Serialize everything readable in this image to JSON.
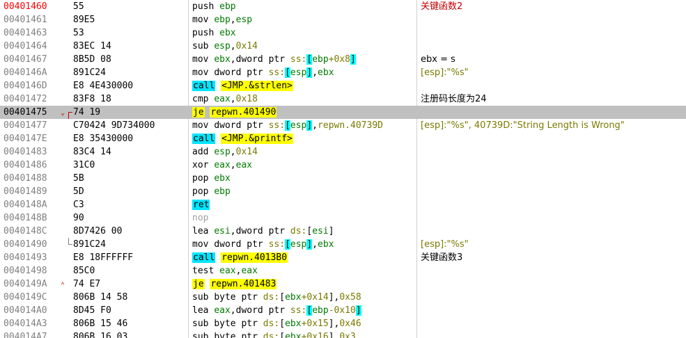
{
  "colors": {
    "eip_address": "#ff0000",
    "selected_row": "#c0c0c0",
    "call_highlight": "#00e5ff",
    "jump_highlight": "#ffff00",
    "register": "#007a00",
    "immediate": "#7a7a00",
    "comment_red": "#c00000"
  },
  "rows": [
    {
      "addr": "00401460",
      "bytes": "55",
      "asm": [
        [
          "mn",
          "push "
        ],
        [
          "reg",
          "ebp"
        ]
      ],
      "cmt": "关键函数2",
      "cmtClass": "red",
      "eip": true
    },
    {
      "addr": "00401461",
      "bytes": "89E5",
      "asm": [
        [
          "mn",
          "mov "
        ],
        [
          "reg",
          "ebp"
        ],
        [
          "txt",
          ","
        ],
        [
          "reg",
          "esp"
        ]
      ],
      "cmt": ""
    },
    {
      "addr": "00401463",
      "bytes": "53",
      "asm": [
        [
          "mn",
          "push "
        ],
        [
          "reg",
          "ebx"
        ]
      ],
      "cmt": ""
    },
    {
      "addr": "00401464",
      "bytes": "83EC 14",
      "asm": [
        [
          "mn",
          "sub "
        ],
        [
          "reg",
          "esp"
        ],
        [
          "txt",
          ","
        ],
        [
          "num",
          "0x14"
        ]
      ],
      "cmt": ""
    },
    {
      "addr": "00401467",
      "bytes": "8B5D 08",
      "asm": [
        [
          "mn",
          "mov "
        ],
        [
          "reg",
          "ebx"
        ],
        [
          "txt",
          ",dword ptr "
        ],
        [
          "seg",
          "ss:"
        ],
        [
          "br",
          "["
        ],
        [
          "reg",
          "ebp"
        ],
        [
          "num",
          "+0x8"
        ],
        [
          "br",
          "]"
        ]
      ],
      "cmt": "ebx = s"
    },
    {
      "addr": "0040146A",
      "bytes": "891C24",
      "asm": [
        [
          "mn",
          "mov "
        ],
        [
          "txt",
          "dword ptr "
        ],
        [
          "seg",
          "ss:"
        ],
        [
          "br",
          "["
        ],
        [
          "reg",
          "esp"
        ],
        [
          "br",
          "]"
        ],
        [
          "txt",
          ","
        ],
        [
          "reg",
          "ebx"
        ]
      ],
      "cmt": "[esp]:\"%s\"",
      "cmtClass": "olive"
    },
    {
      "addr": "0040146D",
      "bytes": "E8 4E430000",
      "asm": [
        [
          "call",
          "call"
        ],
        [
          "txt",
          " "
        ],
        [
          "jmp",
          "<JMP.&strlen>"
        ]
      ],
      "cmt": ""
    },
    {
      "addr": "00401472",
      "bytes": "83F8 18",
      "asm": [
        [
          "mn",
          "cmp "
        ],
        [
          "reg",
          "eax"
        ],
        [
          "txt",
          ","
        ],
        [
          "num",
          "0x18"
        ]
      ],
      "cmt": "注册码长度为24"
    },
    {
      "addr": "00401475",
      "bytes": "74 19",
      "asm": [
        [
          "jmpm",
          "je"
        ],
        [
          "txt",
          " "
        ],
        [
          "jmp",
          "repwn.401490"
        ]
      ],
      "cmt": "",
      "sel": true,
      "jumpMark": "down"
    },
    {
      "addr": "00401477",
      "bytes": "C70424 9D734000",
      "asm": [
        [
          "mn",
          "mov "
        ],
        [
          "txt",
          "dword ptr "
        ],
        [
          "seg",
          "ss:"
        ],
        [
          "br",
          "["
        ],
        [
          "reg",
          "esp"
        ],
        [
          "br",
          "]"
        ],
        [
          "txt",
          ","
        ],
        [
          "num",
          "repwn.40739D"
        ]
      ],
      "cmt": "[esp]:\"%s\", 40739D:\"String Length is Wrong\"",
      "cmtClass": "olive"
    },
    {
      "addr": "0040147E",
      "bytes": "E8 35430000",
      "asm": [
        [
          "call",
          "call"
        ],
        [
          "txt",
          " "
        ],
        [
          "jmp",
          "<JMP.&printf>"
        ]
      ],
      "cmt": ""
    },
    {
      "addr": "00401483",
      "bytes": "83C4 14",
      "asm": [
        [
          "mn",
          "add "
        ],
        [
          "reg",
          "esp"
        ],
        [
          "txt",
          ","
        ],
        [
          "num",
          "0x14"
        ]
      ],
      "cmt": ""
    },
    {
      "addr": "00401486",
      "bytes": "31C0",
      "asm": [
        [
          "mn",
          "xor "
        ],
        [
          "reg",
          "eax"
        ],
        [
          "txt",
          ","
        ],
        [
          "reg",
          "eax"
        ]
      ],
      "cmt": ""
    },
    {
      "addr": "00401488",
      "bytes": "5B",
      "asm": [
        [
          "mn",
          "pop "
        ],
        [
          "reg",
          "ebx"
        ]
      ],
      "cmt": ""
    },
    {
      "addr": "00401489",
      "bytes": "5D",
      "asm": [
        [
          "mn",
          "pop "
        ],
        [
          "reg",
          "ebp"
        ]
      ],
      "cmt": ""
    },
    {
      "addr": "0040148A",
      "bytes": "C3",
      "asm": [
        [
          "call",
          "ret"
        ]
      ],
      "cmt": ""
    },
    {
      "addr": "0040148B",
      "bytes": "90",
      "asm": [
        [
          "nop",
          "nop"
        ]
      ],
      "cmt": ""
    },
    {
      "addr": "0040148C",
      "bytes": "8D7426 00",
      "asm": [
        [
          "mn",
          "lea "
        ],
        [
          "reg",
          "esi"
        ],
        [
          "txt",
          ",dword ptr "
        ],
        [
          "seg",
          "ds:"
        ],
        [
          "txt",
          "["
        ],
        [
          "reg",
          "esi"
        ],
        [
          "txt",
          "]"
        ]
      ],
      "cmt": ""
    },
    {
      "addr": "00401490",
      "bytes": "891C24",
      "asm": [
        [
          "mn",
          "mov "
        ],
        [
          "txt",
          "dword ptr "
        ],
        [
          "seg",
          "ss:"
        ],
        [
          "br",
          "["
        ],
        [
          "reg",
          "esp"
        ],
        [
          "br",
          "]"
        ],
        [
          "txt",
          ","
        ],
        [
          "reg",
          "ebx"
        ]
      ],
      "cmt": "[esp]:\"%s\"",
      "cmtClass": "olive",
      "jumpMark": "target"
    },
    {
      "addr": "00401493",
      "bytes": "E8 18FFFFFF",
      "asm": [
        [
          "call",
          "call"
        ],
        [
          "txt",
          " "
        ],
        [
          "jmp",
          "repwn.4013B0"
        ]
      ],
      "cmt": "关键函数3"
    },
    {
      "addr": "00401498",
      "bytes": "85C0",
      "asm": [
        [
          "mn",
          "test "
        ],
        [
          "reg",
          "eax"
        ],
        [
          "txt",
          ","
        ],
        [
          "reg",
          "eax"
        ]
      ],
      "cmt": ""
    },
    {
      "addr": "0040149A",
      "bytes": "74 E7",
      "asm": [
        [
          "jmpm",
          "je"
        ],
        [
          "txt",
          " "
        ],
        [
          "jmp",
          "repwn.401483"
        ]
      ],
      "cmt": "",
      "jumpMark": "up"
    },
    {
      "addr": "0040149C",
      "bytes": "806B 14 58",
      "asm": [
        [
          "mn",
          "sub "
        ],
        [
          "txt",
          "byte ptr "
        ],
        [
          "seg",
          "ds:"
        ],
        [
          "txt",
          "["
        ],
        [
          "reg",
          "ebx"
        ],
        [
          "num",
          "+0x14"
        ],
        [
          "txt",
          "],"
        ],
        [
          "num",
          "0x58"
        ]
      ],
      "cmt": ""
    },
    {
      "addr": "004014A0",
      "bytes": "8D45 F0",
      "asm": [
        [
          "mn",
          "lea "
        ],
        [
          "reg",
          "eax"
        ],
        [
          "txt",
          ",dword ptr "
        ],
        [
          "seg",
          "ss:"
        ],
        [
          "br",
          "["
        ],
        [
          "reg",
          "ebp"
        ],
        [
          "num",
          "-0x10"
        ],
        [
          "br",
          "]"
        ]
      ],
      "cmt": ""
    },
    {
      "addr": "004014A3",
      "bytes": "806B 15 46",
      "asm": [
        [
          "mn",
          "sub "
        ],
        [
          "txt",
          "byte ptr "
        ],
        [
          "seg",
          "ds:"
        ],
        [
          "txt",
          "["
        ],
        [
          "reg",
          "ebx"
        ],
        [
          "num",
          "+0x15"
        ],
        [
          "txt",
          "],"
        ],
        [
          "num",
          "0x46"
        ]
      ],
      "cmt": ""
    },
    {
      "addr": "004014A7",
      "bytes": "806B 16 03",
      "asm": [
        [
          "mn",
          "sub "
        ],
        [
          "txt",
          "byte ptr "
        ],
        [
          "seg",
          "ds:"
        ],
        [
          "txt",
          "["
        ],
        [
          "reg",
          "ebx"
        ],
        [
          "num",
          "+0x16"
        ],
        [
          "txt",
          "],"
        ],
        [
          "num",
          "0x3"
        ]
      ],
      "cmt": ""
    }
  ]
}
